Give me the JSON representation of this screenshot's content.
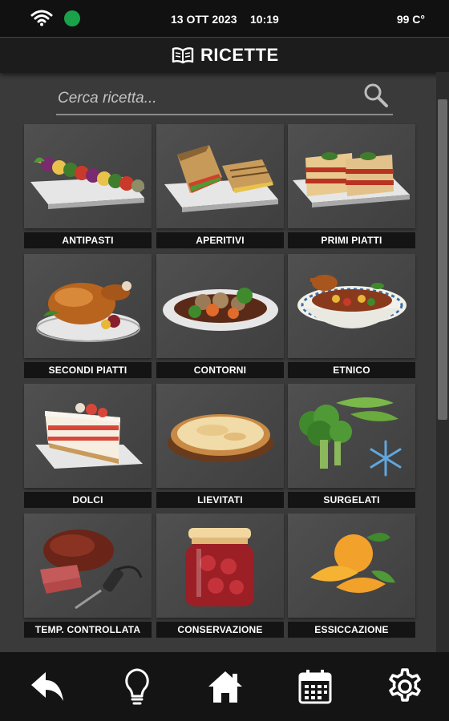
{
  "status": {
    "date": "13 OTT 2023",
    "time": "10:19",
    "temperature": "99 C°"
  },
  "header": {
    "title": "RICETTE"
  },
  "search": {
    "placeholder": "Cerca ricetta..."
  },
  "categories": [
    {
      "label": "ANTIPASTI",
      "icon": "skewers-icon"
    },
    {
      "label": "APERITIVI",
      "icon": "panini-icon"
    },
    {
      "label": "PRIMI PIATTI",
      "icon": "lasagna-icon"
    },
    {
      "label": "SECONDI PIATTI",
      "icon": "roast-chicken-icon"
    },
    {
      "label": "CONTORNI",
      "icon": "vegetables-plate-icon"
    },
    {
      "label": "ETNICO",
      "icon": "duck-bowl-icon"
    },
    {
      "label": "DOLCI",
      "icon": "cake-slice-icon"
    },
    {
      "label": "LIEVITATI",
      "icon": "pie-icon"
    },
    {
      "label": "SURGELATI",
      "icon": "frozen-vegetables-icon"
    },
    {
      "label": "TEMP. CONTROLLATA",
      "icon": "roast-beef-probe-icon"
    },
    {
      "label": "CONSERVAZIONE",
      "icon": "preserve-jar-icon"
    },
    {
      "label": "ESSICCAZIONE",
      "icon": "dried-fruit-icon"
    }
  ],
  "nav": [
    "back-arrow-icon",
    "lightbulb-icon",
    "home-icon",
    "calendar-icon",
    "settings-gear-icon"
  ],
  "colors": {
    "connection_dot": "#19a24a",
    "background": "#3a3a3a",
    "bar": "#141414"
  }
}
